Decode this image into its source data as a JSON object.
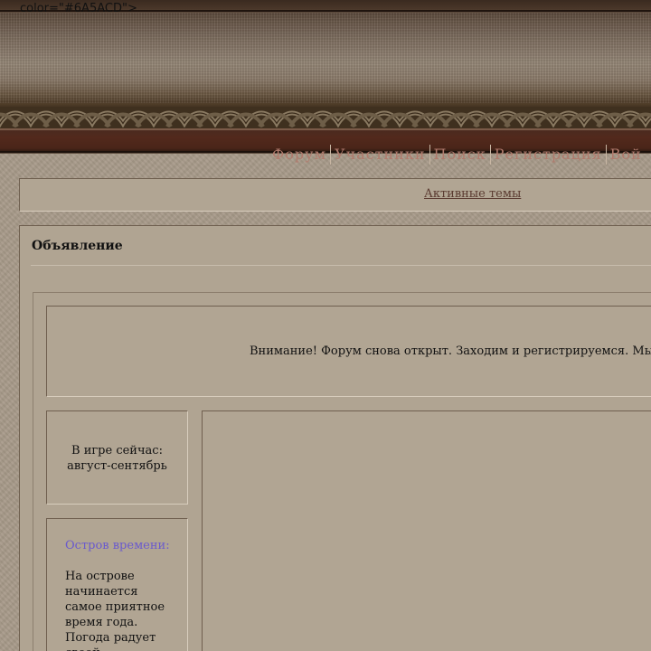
{
  "stray_code_text": "color=\"#6A5ACD\">",
  "nav": {
    "items": [
      "Форум",
      "Участники",
      "Поиск",
      "Регистрация",
      "Вой"
    ]
  },
  "active_topics": {
    "label": "Активные темы"
  },
  "announcement": {
    "title": "Объявление",
    "notice": "Внимание! Форум снова открыт. Заходим и регистрируемся. Мы"
  },
  "sidebar": {
    "season_label": "В игре сейчас:",
    "season_value": "август-сентябрь",
    "island_title": "Остров времени:",
    "island_body": "На острове начинается самое приятное время года. Погода радует своей"
  },
  "colors": {
    "accent_link": "#6A5ACD",
    "nav_text": "#B07A6C",
    "topic_link": "#5A3A30"
  }
}
